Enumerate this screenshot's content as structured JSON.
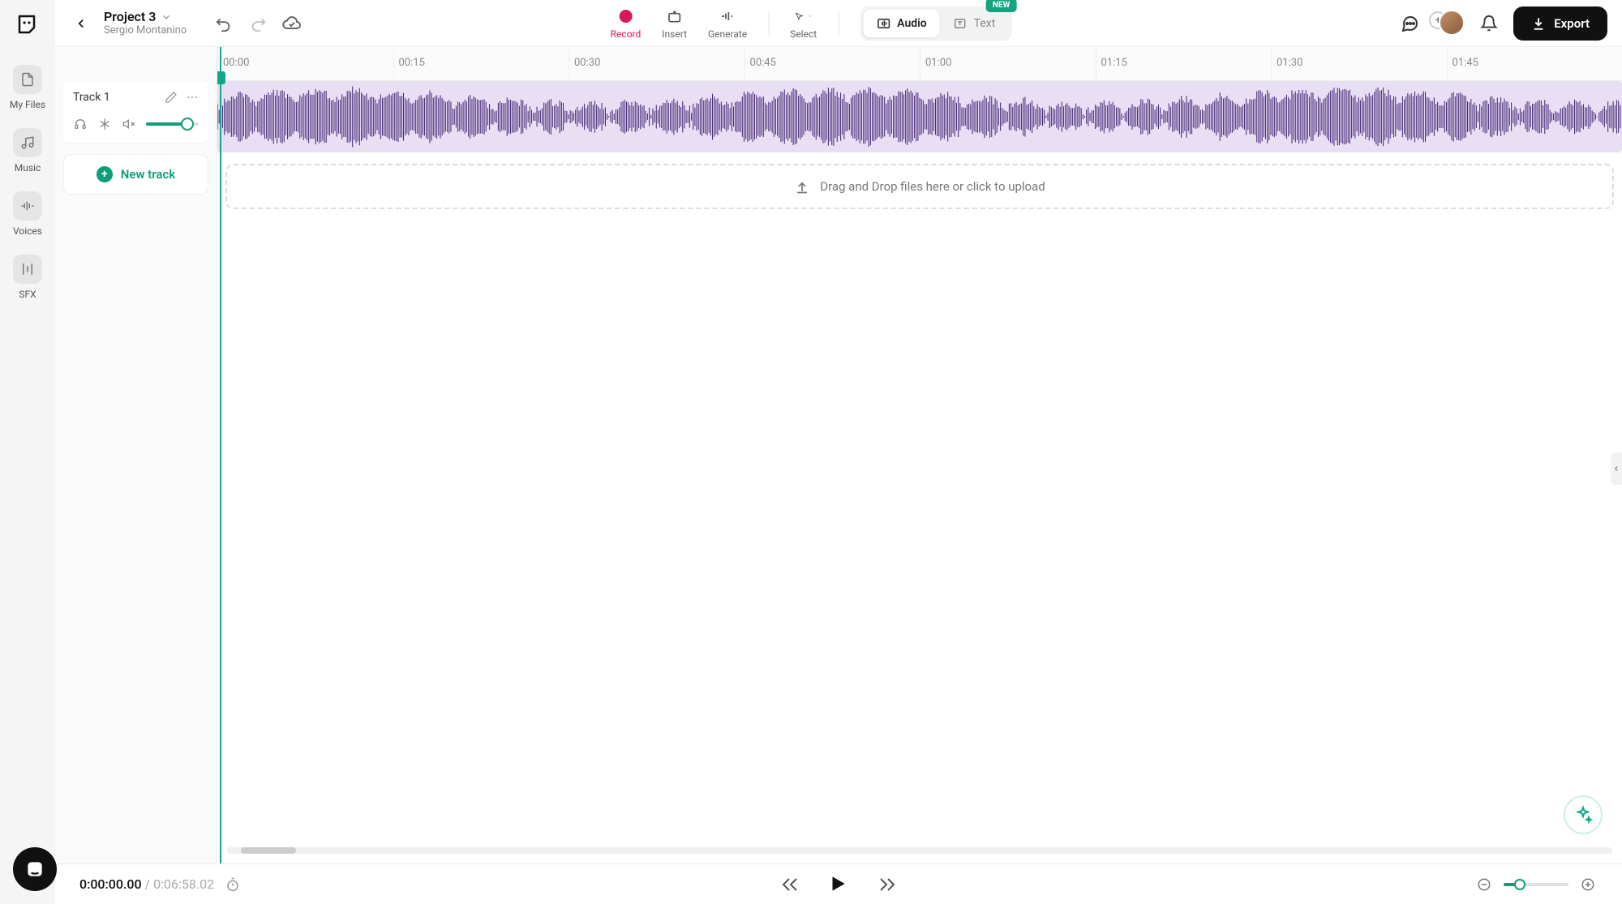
{
  "project": {
    "title": "Project 3",
    "owner": "Sergio Montanino"
  },
  "sidebar": {
    "items": [
      {
        "label": "My Files"
      },
      {
        "label": "Music"
      },
      {
        "label": "Voices"
      },
      {
        "label": "SFX"
      }
    ]
  },
  "tools": {
    "record": "Record",
    "insert": "Insert",
    "generate": "Generate",
    "select": "Select"
  },
  "modes": {
    "audio": "Audio",
    "text": "Text",
    "new_badge": "NEW"
  },
  "export_label": "Export",
  "ruler": {
    "marks": [
      "00:00",
      "00:15",
      "00:30",
      "00:45",
      "01:00",
      "01:15",
      "01:30",
      "01:45"
    ]
  },
  "track": {
    "name": "Track 1"
  },
  "new_track_label": "New track",
  "dropzone_text": "Drag and Drop files here or click to upload",
  "time": {
    "current": "0:00:00.00",
    "total": "0:06:58.02"
  },
  "colors": {
    "accent": "#0f9d7a",
    "record": "#d6195a",
    "wave_bg": "#e8dff4",
    "wave_stroke": "#4a2e7a"
  }
}
